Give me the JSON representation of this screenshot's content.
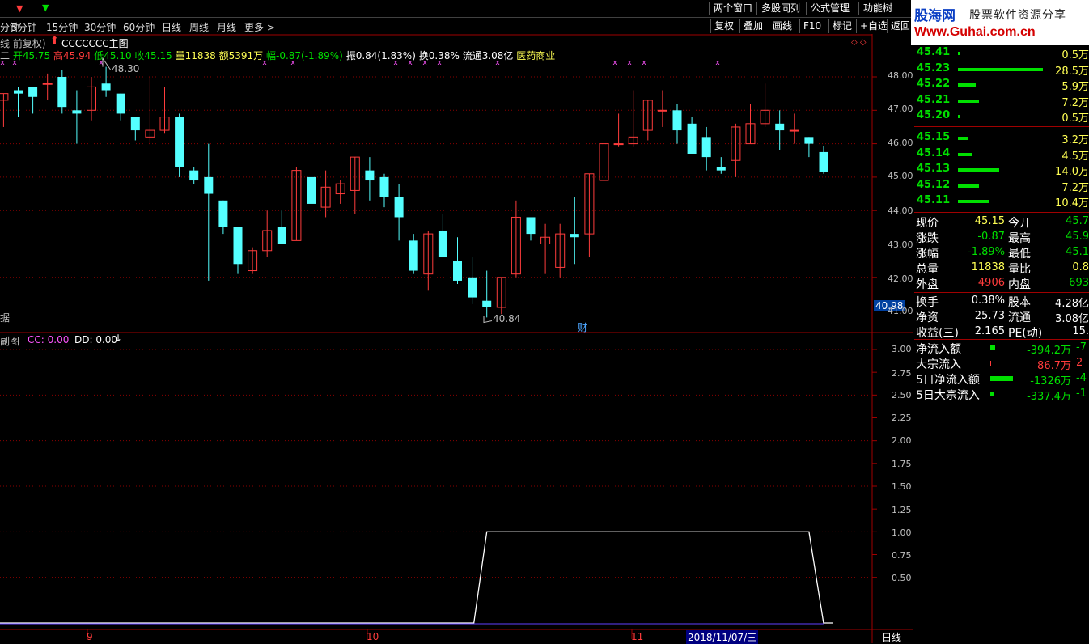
{
  "toolbar": {
    "windows_label": "两个窗口",
    "multi_label": "多股同列",
    "formula_label": "公式管理",
    "function_label": "功能树",
    "periods": [
      "分钟",
      "5分钟",
      "15分钟",
      "30分钟",
      "60分钟",
      "日线",
      "周线",
      "月线",
      "更多 >"
    ],
    "tools": [
      "复权",
      "叠加",
      "画线",
      "F10",
      "标记",
      "+自选",
      "返回"
    ]
  },
  "banner": {
    "title": "股海网",
    "slogan": "股票软件资源分享",
    "url": "Www.Guhai.com.cn"
  },
  "chart": {
    "title_prefix": "线 前复权)",
    "indicator_title": "CCCCCCC主图",
    "quote_line": {
      "prefix": "二",
      "open": "开45.75",
      "high": "高45.94",
      "low": "低45.10",
      "close": "收45.15",
      "volume": "量11838",
      "amount": "额5391万",
      "change": "幅-0.87(-1.89%)",
      "amplitude": "振0.84(1.83%)",
      "turnover": "换0.38%",
      "float_cap": "流通3.08亿",
      "industry": "医药商业"
    },
    "high_marker": "48.30",
    "low_marker": "40.84",
    "fin_marker": "财",
    "side_char": "据",
    "price_axis": [
      "48.00",
      "47.00",
      "46.00",
      "45.00",
      "44.00",
      "43.00",
      "42.00",
      "41.00"
    ],
    "current_price_tag": "40.98",
    "sub_title": "副图",
    "sub_cc": "CC: 0.00",
    "sub_dd": "DD: 0.00",
    "sub_axis": [
      "3.00",
      "2.75",
      "2.50",
      "2.25",
      "2.00",
      "1.75",
      "1.50",
      "1.25",
      "1.00",
      "0.75",
      "0.50"
    ],
    "date_labels": [
      "9",
      "10",
      "11"
    ],
    "cursor_date": "2018/11/07/三",
    "period_label": "日线"
  },
  "chart_data": {
    "type": "candlestick",
    "candles": [
      [
        47.3,
        47.5,
        46.5,
        47.5
      ],
      [
        47.6,
        47.7,
        46.8,
        47.5
      ],
      [
        47.7,
        47.6,
        46.9,
        47.4
      ],
      [
        47.8,
        48.1,
        47.3,
        47.8
      ],
      [
        48.0,
        48.2,
        46.9,
        47.1
      ],
      [
        47.0,
        47.6,
        46.0,
        46.9
      ],
      [
        47.0,
        48.0,
        46.7,
        47.7
      ],
      [
        47.8,
        48.3,
        47.4,
        47.6
      ],
      [
        47.5,
        47.5,
        46.7,
        46.9
      ],
      [
        46.8,
        46.8,
        46.1,
        46.4
      ],
      [
        46.2,
        48.0,
        46.0,
        46.4
      ],
      [
        46.4,
        47.7,
        46.3,
        46.8
      ],
      [
        46.8,
        46.9,
        45.0,
        45.3
      ],
      [
        45.2,
        45.3,
        44.8,
        44.9
      ],
      [
        45.0,
        46.0,
        41.9,
        44.5
      ],
      [
        44.3,
        44.3,
        43.3,
        43.5
      ],
      [
        43.5,
        43.5,
        42.1,
        42.4
      ],
      [
        42.2,
        42.9,
        42.1,
        42.8
      ],
      [
        42.8,
        44.0,
        42.6,
        43.4
      ],
      [
        43.5,
        44.0,
        43.0,
        43.0
      ],
      [
        43.1,
        45.3,
        43.1,
        45.2
      ],
      [
        45.0,
        45.0,
        44.0,
        44.2
      ],
      [
        44.1,
        45.2,
        43.8,
        44.7
      ],
      [
        44.5,
        44.9,
        44.2,
        44.8
      ],
      [
        44.6,
        45.6,
        43.9,
        45.6
      ],
      [
        45.2,
        45.6,
        44.3,
        44.9
      ],
      [
        45.0,
        45.1,
        44.1,
        44.4
      ],
      [
        44.4,
        44.8,
        43.1,
        43.8
      ],
      [
        43.1,
        43.3,
        42.1,
        42.2
      ],
      [
        42.1,
        43.4,
        41.6,
        43.3
      ],
      [
        43.4,
        43.9,
        42.6,
        42.6
      ],
      [
        42.5,
        43.2,
        41.8,
        41.9
      ],
      [
        42.0,
        42.6,
        41.2,
        41.4
      ],
      [
        41.3,
        42.2,
        40.8,
        41.1
      ],
      [
        41.1,
        42.0,
        40.9,
        42.0
      ],
      [
        42.1,
        44.3,
        42.0,
        43.8
      ],
      [
        43.8,
        43.8,
        43.1,
        43.3
      ],
      [
        43.0,
        43.6,
        42.1,
        43.2
      ],
      [
        42.3,
        43.6,
        42.0,
        43.3
      ],
      [
        43.3,
        44.4,
        42.4,
        43.2
      ],
      [
        43.3,
        45.1,
        42.6,
        45.1
      ],
      [
        44.9,
        46.0,
        44.7,
        46.0
      ],
      [
        46.0,
        46.9,
        45.9,
        46.0
      ],
      [
        46.0,
        47.6,
        45.9,
        46.2
      ],
      [
        46.4,
        47.3,
        46.1,
        47.3
      ],
      [
        47.0,
        47.6,
        46.5,
        47.0
      ],
      [
        47.0,
        47.2,
        46.0,
        46.4
      ],
      [
        46.6,
        46.8,
        45.8,
        45.7
      ],
      [
        46.2,
        46.5,
        45.2,
        45.6
      ],
      [
        45.3,
        45.6,
        45.1,
        45.2
      ],
      [
        45.5,
        46.6,
        45.0,
        46.5
      ],
      [
        46.0,
        47.2,
        46.0,
        46.6
      ],
      [
        46.6,
        47.8,
        46.5,
        47.0
      ],
      [
        46.6,
        47.0,
        45.8,
        46.4
      ],
      [
        46.4,
        46.9,
        46.0,
        46.4
      ],
      [
        46.2,
        46.2,
        45.6,
        46.0
      ],
      [
        45.75,
        45.94,
        45.1,
        45.15
      ]
    ],
    "markers": {
      "high": 48.3,
      "low": 40.84
    },
    "ylim": [
      40.7,
      48.6
    ],
    "sub_series": {
      "name": "CC",
      "segments": [
        {
          "from_idx": 33,
          "to_idx": 55,
          "value": 1.0
        }
      ],
      "ylim": [
        0,
        3.15
      ]
    }
  },
  "order_book": {
    "asks": [
      {
        "p": "45.41",
        "v": "0.5万",
        "w": 1
      },
      {
        "p": "45.23",
        "v": "28.5万",
        "w": 100
      },
      {
        "p": "45.22",
        "v": "5.9万",
        "w": 21
      },
      {
        "p": "45.21",
        "v": "7.2万",
        "w": 25
      },
      {
        "p": "45.20",
        "v": "0.5万",
        "w": 2
      }
    ],
    "bids": [
      {
        "p": "45.15",
        "v": "3.2万",
        "w": 11
      },
      {
        "p": "45.14",
        "v": "4.5万",
        "w": 16
      },
      {
        "p": "45.13",
        "v": "14.0万",
        "w": 49
      },
      {
        "p": "45.12",
        "v": "7.2万",
        "w": 25
      },
      {
        "p": "45.11",
        "v": "10.4万",
        "w": 37
      }
    ]
  },
  "stats": {
    "rows1": [
      {
        "l1": "现价",
        "v1": "45.15",
        "c1": "#ffff54",
        "l2": "今开",
        "v2": "45.7",
        "c2": "#00e000"
      },
      {
        "l1": "涨跌",
        "v1": "-0.87",
        "c1": "#00e000",
        "l2": "最高",
        "v2": "45.9",
        "c2": "#00e000"
      },
      {
        "l1": "涨幅",
        "v1": "-1.89%",
        "c1": "#00e000",
        "l2": "最低",
        "v2": "45.1",
        "c2": "#00e000"
      },
      {
        "l1": "总量",
        "v1": "11838",
        "c1": "#ffff54",
        "l2": "量比",
        "v2": "0.8",
        "c2": "#ffff54"
      },
      {
        "l1": "外盘",
        "v1": "4906",
        "c1": "#ff3c3c",
        "l2": "内盘",
        "v2": "693",
        "c2": "#00e000"
      }
    ],
    "rows2": [
      {
        "l1": "换手",
        "v1": "0.38%",
        "c1": "#ffffff",
        "l2": "股本",
        "v2": "4.28亿",
        "c2": "#ffffff"
      },
      {
        "l1": "净资",
        "v1": "25.73",
        "c1": "#ffffff",
        "l2": "流通",
        "v2": "3.08亿",
        "c2": "#ffffff"
      },
      {
        "l1": "收益(三)",
        "v1": "2.165",
        "c1": "#ffffff",
        "l2": "PE(动)",
        "v2": "15.",
        "c2": "#ffffff"
      }
    ],
    "flows": [
      {
        "l": "净流入额",
        "v": "-394.2万",
        "v2": "-7",
        "c": "#00e000",
        "bw": 6
      },
      {
        "l": "大宗流入",
        "v": "86.7万",
        "v2": "2",
        "c": "#ff3c3c",
        "bw": 1
      },
      {
        "l": "5日净流入额",
        "v": "-1326万",
        "v2": "-4",
        "c": "#00e000",
        "bw": 28
      },
      {
        "l": "5日大宗流入",
        "v": "-337.4万",
        "v2": "-1",
        "c": "#00e000",
        "bw": 5
      }
    ]
  },
  "colors": {
    "up": "#ff3c3c",
    "down": "#54ffff",
    "grid": "#a00000",
    "volume_up": "#ff3c3c"
  }
}
